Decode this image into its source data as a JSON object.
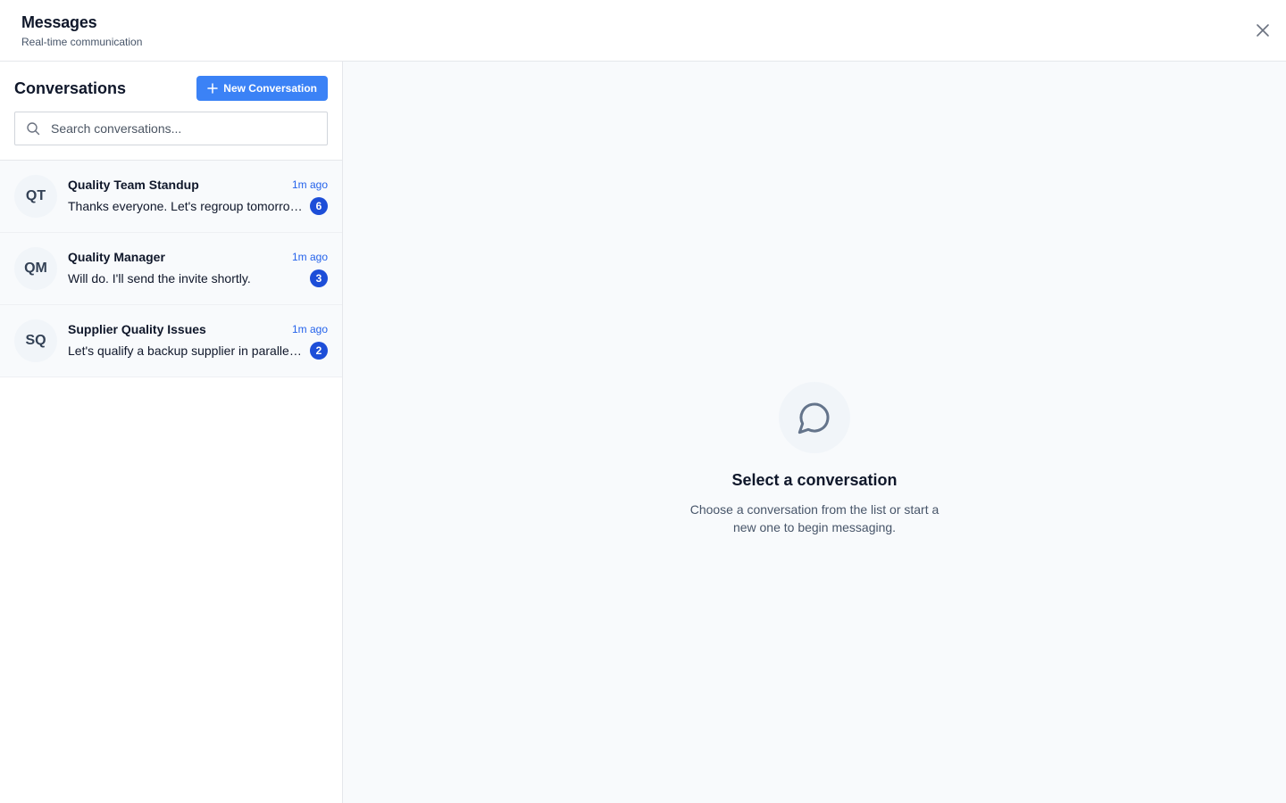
{
  "header": {
    "title": "Messages",
    "subtitle": "Real-time communication",
    "close_icon": "close-icon"
  },
  "sidebar": {
    "title": "Conversations",
    "new_button_label": "New Conversation",
    "search": {
      "placeholder": "Search conversations...",
      "value": ""
    },
    "conversations": [
      {
        "initials": "QT",
        "name": "Quality Team Standup",
        "time": "1m ago",
        "preview": "Thanks everyone. Let's regroup tomorrow morning.",
        "unread": "6"
      },
      {
        "initials": "QM",
        "name": "Quality Manager",
        "time": "1m ago",
        "preview": "Will do. I'll send the invite shortly.",
        "unread": "3"
      },
      {
        "initials": "SQ",
        "name": "Supplier Quality Issues",
        "time": "1m ago",
        "preview": "Let's qualify a backup supplier in parallel. Please share the list.",
        "unread": "2"
      }
    ]
  },
  "main": {
    "empty_icon": "message-circle-icon",
    "empty_title": "Select a conversation",
    "empty_description": "Choose a conversation from the list or start a new one to begin messaging."
  },
  "colors": {
    "accent": "#3b82f6",
    "badge": "#1d4ed8",
    "time": "#2563eb",
    "panel_bg": "#f8fafc"
  }
}
